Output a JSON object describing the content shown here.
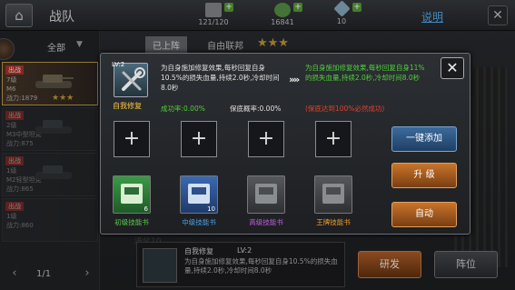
{
  "header": {
    "home_icon": "home-icon",
    "title": "战队",
    "resources": [
      {
        "name": "capacity",
        "value": "121/120",
        "color": "#8c8f93"
      },
      {
        "name": "coins",
        "value": "16841",
        "color": "#5a9a4a"
      },
      {
        "name": "diamonds",
        "value": "10",
        "color": "#8fb6c8"
      }
    ],
    "help_label": "说明",
    "close_label": "✕"
  },
  "left": {
    "filter": "全部",
    "cards": [
      {
        "tag": "出战",
        "line1": "7级",
        "line2": "M6",
        "line3": "战力:1879",
        "stars": "★★★",
        "selected": true
      },
      {
        "tag": "出战",
        "line1": "2级",
        "line2": "M3中型坦克",
        "line3": "战力:875",
        "stars": "",
        "selected": false
      },
      {
        "tag": "出战",
        "line1": "1级",
        "line2": "M2轻型坦克",
        "line3": "战力:865",
        "stars": "",
        "selected": false
      },
      {
        "tag": "出战",
        "line1": "1级",
        "line2": "",
        "line3": "战力:860",
        "stars": "",
        "selected": false
      }
    ],
    "page": "1/1"
  },
  "background": {
    "tab1": "已上阵",
    "tab2": "自由联邦",
    "stars": "★★★",
    "faint_text": "进化10",
    "skill_card": {
      "name": "自我修复",
      "level": "LV:2",
      "desc": "为自身施加修复效果,每秒回复自身10.5%的损失血量,持续2.0秒,冷却时间8.0秒"
    },
    "btn_research": "研发",
    "btn_formation": "阵位"
  },
  "dialog": {
    "close_label": "✕",
    "skill": {
      "level": "LV:2",
      "name": "自我修复"
    },
    "desc_current": "为自身施加修复效果,每秒回复自身10.5%的损失血量,持续2.0秒,冷却时间8.0秒",
    "arrows": "»»",
    "desc_next": "为自身施加修复效果,每秒回复自身11%的损失血量,持续2.0秒,冷却时间8.0秒",
    "success_rate": "成功率:0.00%",
    "guard_rate": "保底概率:0.00%",
    "guard_note": "(保底达到100%必然成功)",
    "slots": [
      "+",
      "+",
      "+",
      "+"
    ],
    "books": [
      {
        "label": "初级技能书",
        "count": "6",
        "color": "#2f8a3a",
        "label_color": "#5ad24a"
      },
      {
        "label": "中级技能书",
        "count": "10",
        "color": "#2f5f9e",
        "label_color": "#4aa4e8"
      },
      {
        "label": "高级技能书",
        "count": "",
        "color": "#4a4d52",
        "label_color": "#c060e0"
      },
      {
        "label": "王牌技能书",
        "count": "",
        "color": "#4a4d52",
        "label_color": "#f0a030"
      }
    ],
    "btn_auto_add": "一键添加",
    "btn_upgrade": "升 级",
    "btn_auto": "自动"
  }
}
